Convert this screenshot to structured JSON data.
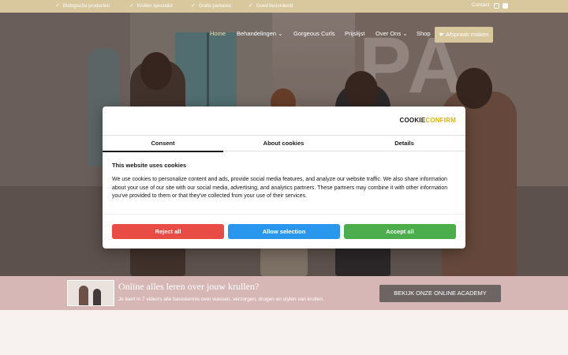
{
  "topbar": {
    "usps": [
      "Biologische producten",
      "Krullen specialist",
      "Gratis parkeren",
      "Goed beoordeeld"
    ],
    "contact": "Contact",
    "social_icons": [
      "instagram-icon",
      "facebook-icon"
    ]
  },
  "nav": {
    "items": [
      "Home",
      "Behandelingen",
      "Gorgeous Curls",
      "Prijslijst",
      "Over Ons",
      "Shop"
    ],
    "cta": "Afspraak maken"
  },
  "cookie": {
    "logo_part1": "COOKIE",
    "logo_part2": "CONFIRM",
    "tabs": [
      "Consent",
      "About cookies",
      "Details"
    ],
    "title": "This website uses cookies",
    "text": "We use cookies to personalize content and ads, provide social media features, and analyze our website traffic. We also share information about your use of our site with our social media, advertising, and analytics partners. These partners may combine it with other information you've provided to them or that they've collected from your use of their services.",
    "buttons": {
      "reject": "Reject all",
      "allow": "Allow selection",
      "accept": "Accept all"
    }
  },
  "academy": {
    "title": "Online alles leren over jouw krullen?",
    "subtitle": "Je leert in 7 video's alle basiskennis over wassen, verzorgen, drogen en stylen van krullen.",
    "button": "BEKIJK ONZE ONLINE ACADEMY"
  },
  "colors": {
    "topbar": "#d9c79d",
    "reject": "#e94b45",
    "allow": "#2a97ee",
    "accept": "#4bad4b",
    "strip": "#d7b7b6"
  }
}
